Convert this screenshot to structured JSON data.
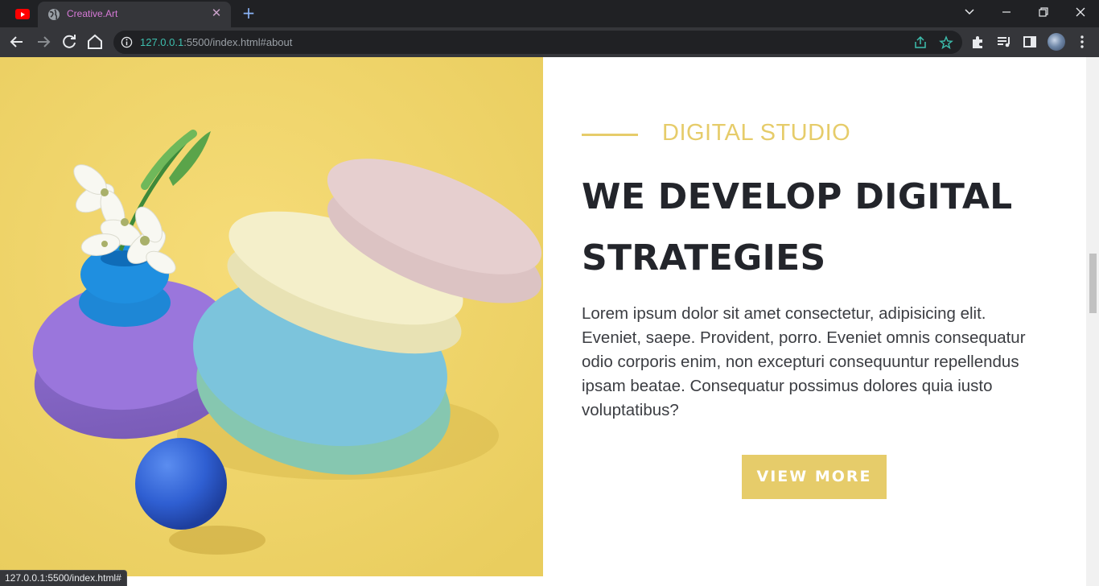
{
  "browser": {
    "tab_title": "Creative.Art",
    "new_tab_symbol": "+",
    "close_symbol": "✕",
    "url_host": "127.0.0.1",
    "url_rest": ":5500/index.html#about",
    "status_url": "127.0.0.1:5500/index.html#",
    "accent_color": "#8ab4f8",
    "icons": [
      "youtube-icon",
      "globe-icon",
      "back-icon",
      "forward-icon",
      "reload-icon",
      "home-icon",
      "info-icon",
      "share-icon",
      "bookmark-star-icon",
      "extensions-icon",
      "media-queue-icon",
      "side-panel-icon",
      "avatar",
      "menu-icon",
      "tab-search-chevron-icon",
      "minimize-icon",
      "restore-icon",
      "close-window-icon"
    ]
  },
  "about": {
    "eyebrow": "DIGITAL STUDIO",
    "headline": "WE DEVELOP DIGITAL STRATEGIES",
    "body": "Lorem ipsum dolor sit amet consectetur, adipisicing elit. Eveniet, saepe. Provident, porro. Eveniet omnis consequatur odio corporis enim, non excepturi consequuntur repellendus ipsam beatae. Consequatur possimus dolores quia iusto voluptatibus?",
    "button_label": "VIEW MORE",
    "accent_color": "#e6cc6a",
    "image_description_icon": "pastel-shapes-image"
  }
}
